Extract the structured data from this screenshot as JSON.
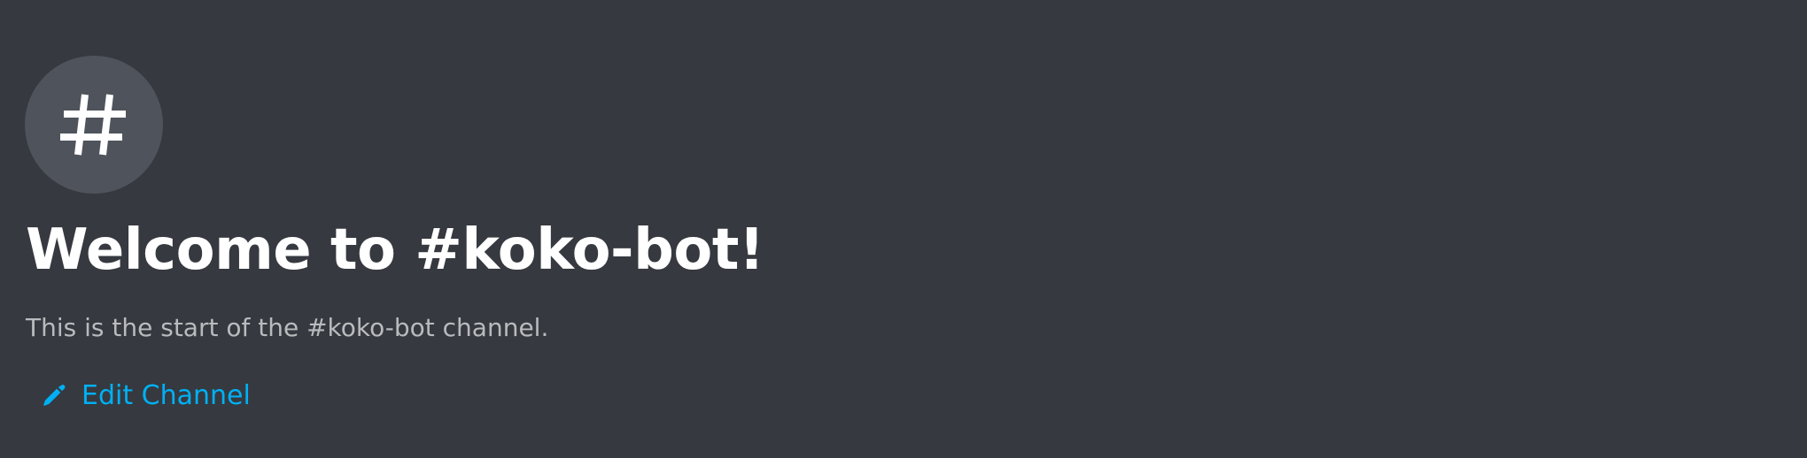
{
  "channel": {
    "icon": "hashtag-icon",
    "welcome_title": "Welcome to #koko-bot!",
    "welcome_subtitle": "This is the start of the #koko-bot channel.",
    "edit_label": "Edit Channel",
    "edit_icon": "pencil-icon"
  },
  "colors": {
    "background": "#36393f",
    "icon_circle": "#4f545c",
    "title": "#ffffff",
    "subtitle": "#b9bbbe",
    "link": "#00b0f4"
  }
}
